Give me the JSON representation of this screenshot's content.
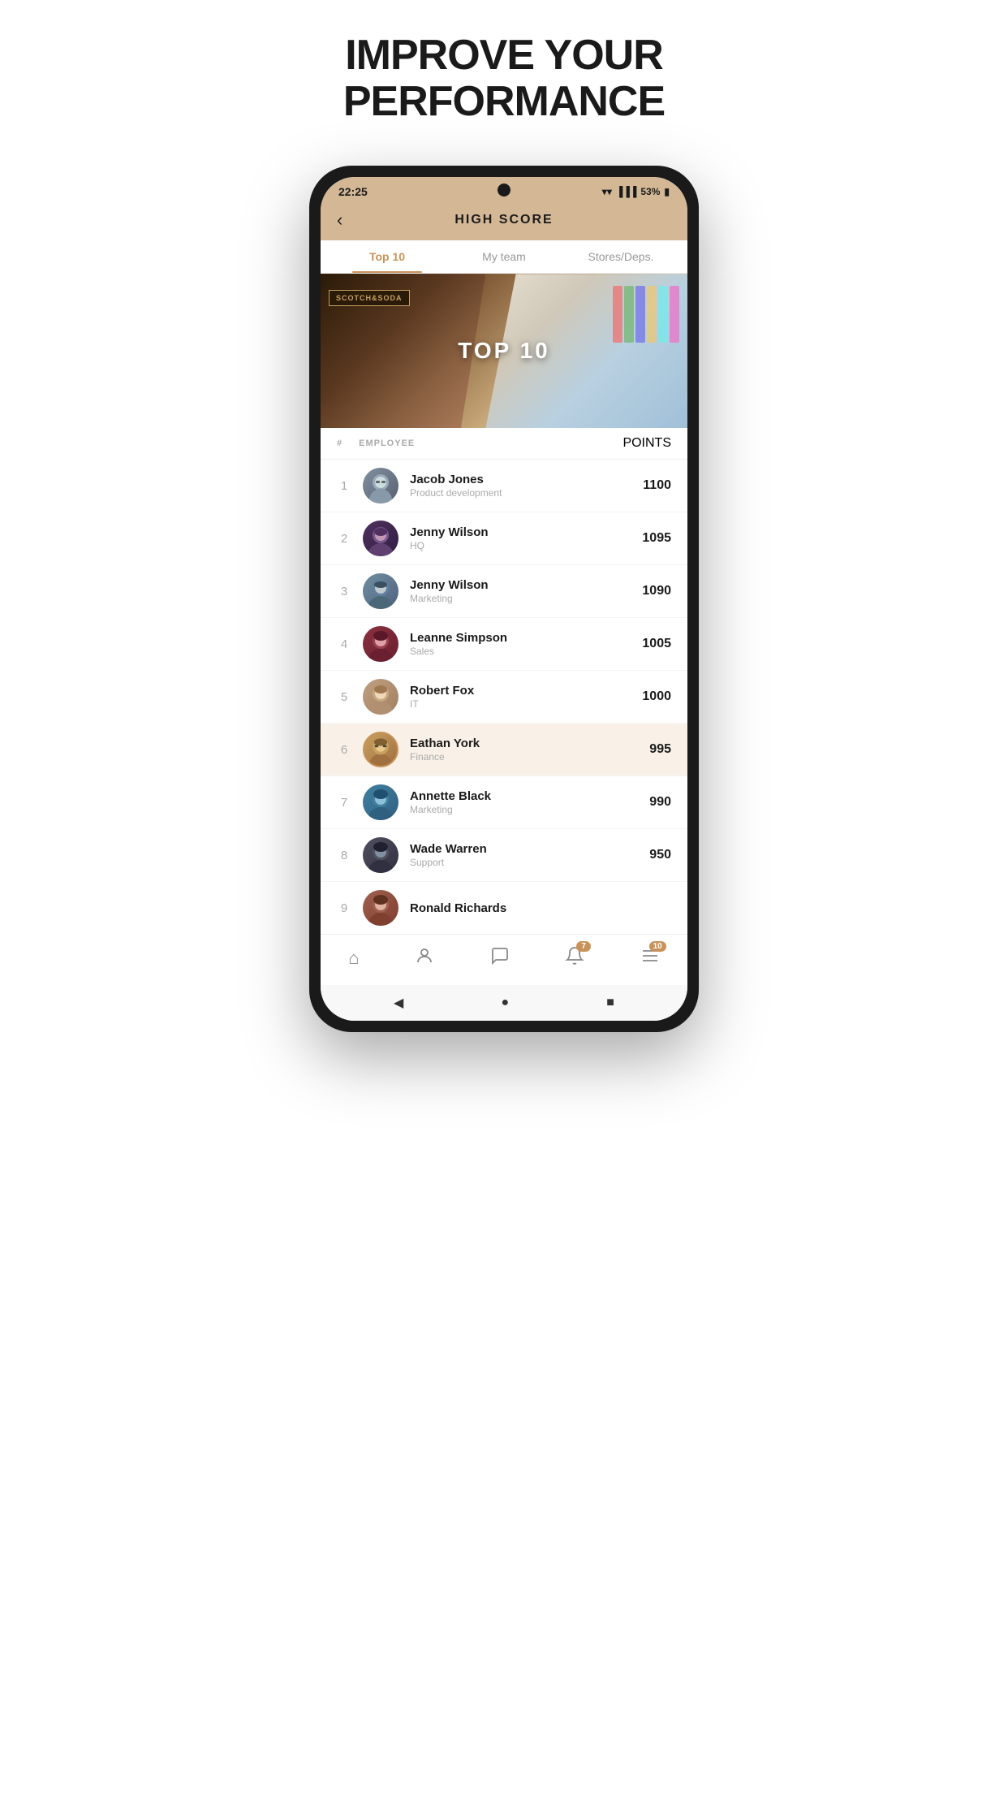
{
  "headline": {
    "line1": "IMPROVE YOUR",
    "line2": "PERFORMANCE"
  },
  "statusBar": {
    "time": "22:25",
    "wifi": "WiFi",
    "signal": "Signal",
    "battery": "53%"
  },
  "header": {
    "title": "HIGH SCORE",
    "backLabel": "‹"
  },
  "tabs": [
    {
      "id": "top10",
      "label": "Top 10",
      "active": true
    },
    {
      "id": "myteam",
      "label": "My team",
      "active": false
    },
    {
      "id": "storesdeps",
      "label": "Stores/Deps.",
      "active": false
    }
  ],
  "banner": {
    "label": "TOP 10"
  },
  "listHeader": {
    "hash": "#",
    "employee": "EMPLOYEE",
    "points": "POINTS"
  },
  "employees": [
    {
      "rank": 1,
      "name": "Jacob Jones",
      "dept": "Product development",
      "points": "1100",
      "avatar": "av-1",
      "highlighted": false
    },
    {
      "rank": 2,
      "name": "Jenny Wilson",
      "dept": "HQ",
      "points": "1095",
      "avatar": "av-2",
      "highlighted": false
    },
    {
      "rank": 3,
      "name": "Jenny Wilson",
      "dept": "Marketing",
      "points": "1090",
      "avatar": "av-3",
      "highlighted": false
    },
    {
      "rank": 4,
      "name": "Leanne Simpson",
      "dept": "Sales",
      "points": "1005",
      "avatar": "av-4",
      "highlighted": false
    },
    {
      "rank": 5,
      "name": "Robert Fox",
      "dept": "IT",
      "points": "1000",
      "avatar": "av-5",
      "highlighted": false
    },
    {
      "rank": 6,
      "name": "Eathan York",
      "dept": "Finance",
      "points": "995",
      "avatar": "av-6",
      "highlighted": true
    },
    {
      "rank": 7,
      "name": "Annette Black",
      "dept": "Marketing",
      "points": "990",
      "avatar": "av-7",
      "highlighted": false
    },
    {
      "rank": 8,
      "name": "Wade Warren",
      "dept": "Support",
      "points": "950",
      "avatar": "av-8",
      "highlighted": false
    }
  ],
  "partialRow": {
    "rank": 9,
    "name": "Ronald Richards",
    "avatar": "av-9"
  },
  "bottomNav": [
    {
      "id": "home",
      "icon": "⌂",
      "label": "Home",
      "badge": null
    },
    {
      "id": "profile",
      "icon": "◯",
      "label": "Profile",
      "badge": null
    },
    {
      "id": "chat",
      "icon": "◻",
      "label": "Chat",
      "badge": null
    },
    {
      "id": "notifications",
      "icon": "🔔",
      "label": "Notifications",
      "badge": "7"
    },
    {
      "id": "menu",
      "icon": "≡",
      "label": "Menu",
      "badge": "10"
    }
  ],
  "androidNav": {
    "back": "◀",
    "home": "●",
    "recent": "■"
  }
}
